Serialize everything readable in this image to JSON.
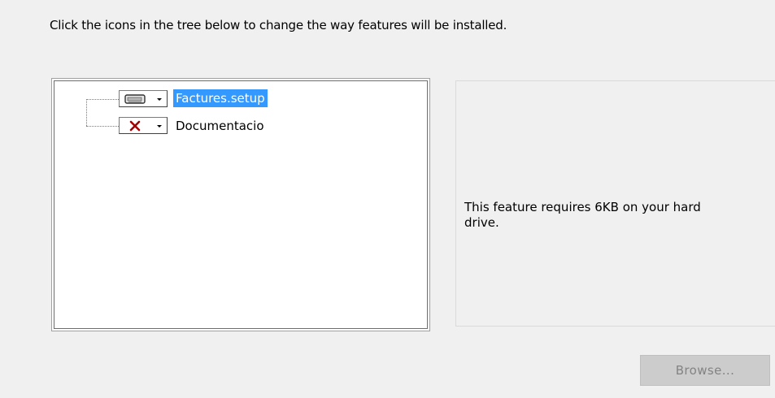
{
  "instruction": "Click the icons in the tree below to change the way features will be installed.",
  "tree": {
    "items": [
      {
        "label": "Factures.setup",
        "icon": "hard-drive-icon",
        "selected": true
      },
      {
        "label": "Documentacio",
        "icon": "red-x-icon",
        "selected": false
      }
    ]
  },
  "description": {
    "text": "This feature requires 6KB on your hard drive."
  },
  "buttons": {
    "browse_label": "Browse..."
  },
  "colors": {
    "background": "#f0f0f0",
    "selection": "#3399ff",
    "not_available_x": "#a00000",
    "disabled_button": "#cccccc"
  }
}
